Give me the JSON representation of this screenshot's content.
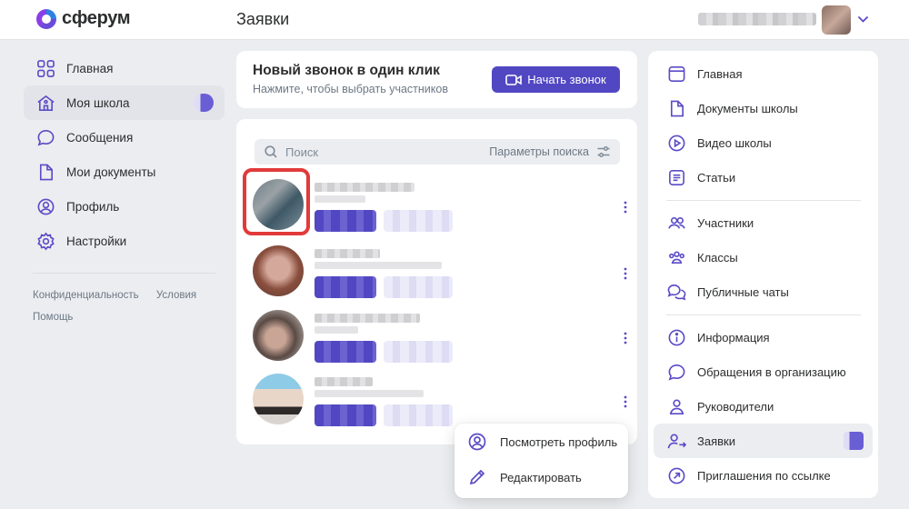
{
  "header": {
    "logo_text": "сферум",
    "page_title": "Заявки"
  },
  "left_nav": {
    "items": [
      {
        "label": "Главная",
        "icon": "grid-icon"
      },
      {
        "label": "Моя школа",
        "icon": "school-icon",
        "active": true
      },
      {
        "label": "Сообщения",
        "icon": "message-icon"
      },
      {
        "label": "Мои документы",
        "icon": "document-icon"
      },
      {
        "label": "Профиль",
        "icon": "profile-icon"
      },
      {
        "label": "Настройки",
        "icon": "gear-icon"
      }
    ],
    "footer": {
      "privacy": "Конфиденциальность",
      "terms": "Условия",
      "help": "Помощь"
    }
  },
  "call_card": {
    "title": "Новый звонок в один клик",
    "subtitle": "Нажмите, чтобы выбрать участников",
    "button_label": "Начать звонок"
  },
  "search": {
    "placeholder": "Поиск",
    "params_label": "Параметры поиска"
  },
  "context_menu": {
    "items": [
      {
        "label": "Посмотреть профиль",
        "icon": "profile-icon"
      },
      {
        "label": "Редактировать",
        "icon": "pencil-icon"
      }
    ]
  },
  "right_panel": {
    "items": [
      {
        "label": "Главная",
        "icon": "browser-icon"
      },
      {
        "label": "Документы школы",
        "icon": "document-icon"
      },
      {
        "label": "Видео школы",
        "icon": "play-icon"
      },
      {
        "label": "Статьи",
        "icon": "article-icon"
      },
      {
        "label": "Участники",
        "icon": "users-icon"
      },
      {
        "label": "Классы",
        "icon": "classes-icon"
      },
      {
        "label": "Публичные чаты",
        "icon": "chats-icon"
      },
      {
        "label": "Информация",
        "icon": "info-icon"
      },
      {
        "label": "Обращения в организацию",
        "icon": "message-icon"
      },
      {
        "label": "Руководители",
        "icon": "person-icon"
      },
      {
        "label": "Заявки",
        "icon": "person-arrow-icon",
        "active": true
      },
      {
        "label": "Приглашения по ссылке",
        "icon": "link-arrow-icon"
      }
    ]
  },
  "colors": {
    "accent": "#5247c2",
    "highlight": "#e23a3a",
    "background": "#ebedf0"
  }
}
